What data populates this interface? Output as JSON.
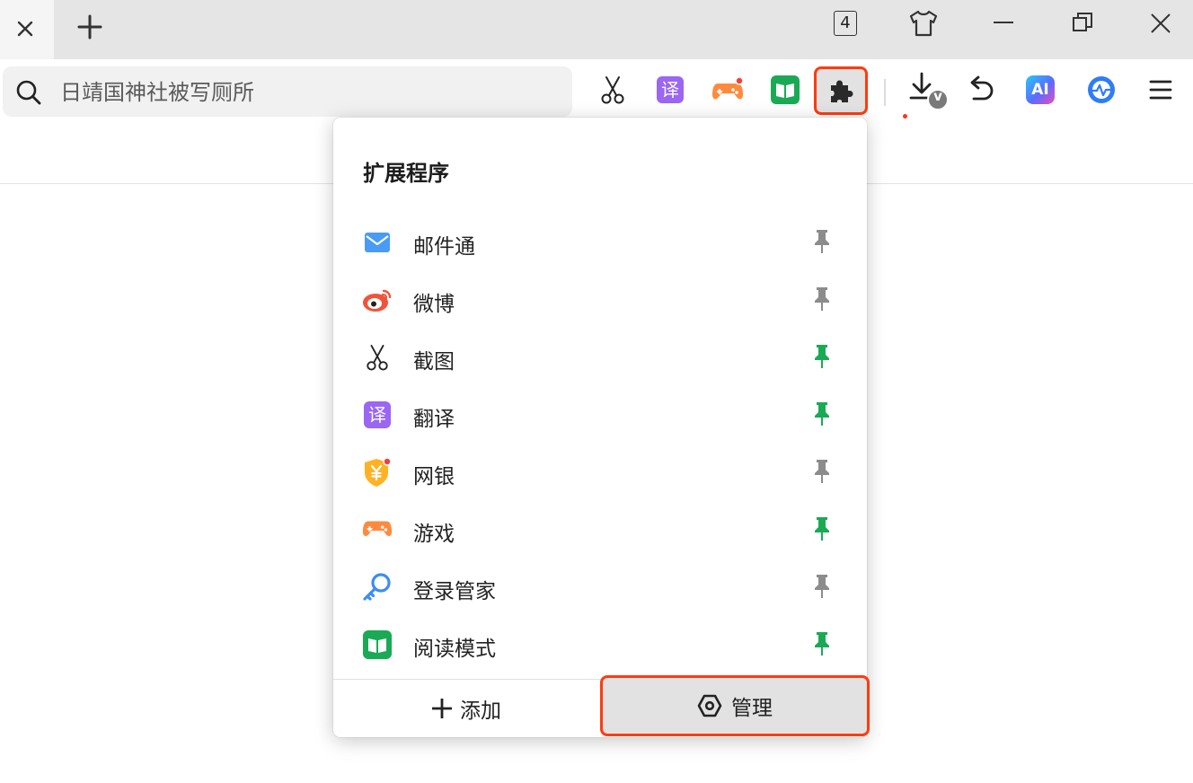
{
  "tabs": {
    "count": "4"
  },
  "address_bar": {
    "placeholder": "日靖国神社被写厕所"
  },
  "popup": {
    "title": "扩展程序",
    "items": [
      {
        "label": "邮件通",
        "icon": "mail-icon",
        "pinned": false
      },
      {
        "label": "微博",
        "icon": "weibo-icon",
        "pinned": false
      },
      {
        "label": "截图",
        "icon": "scissors-icon",
        "pinned": true
      },
      {
        "label": "翻译",
        "icon": "translate-icon",
        "pinned": true
      },
      {
        "label": "网银",
        "icon": "bank-shield-icon",
        "pinned": false
      },
      {
        "label": "游戏",
        "icon": "gamepad-icon",
        "pinned": true
      },
      {
        "label": "登录管家",
        "icon": "key-icon",
        "pinned": false
      },
      {
        "label": "阅读模式",
        "icon": "book-icon",
        "pinned": true
      }
    ],
    "add_label": "添加",
    "manage_label": "管理"
  },
  "toolbar": {
    "translate_glyph": "译",
    "ai_label": "AI",
    "download_badge": "v"
  },
  "colors": {
    "highlight": "#ff3b0f",
    "pin_active": "#1aaa55",
    "pin_inactive": "#8c8c8c",
    "translate": "#9a66f2",
    "game": "#ff8a3d",
    "reader": "#1aaa55"
  }
}
